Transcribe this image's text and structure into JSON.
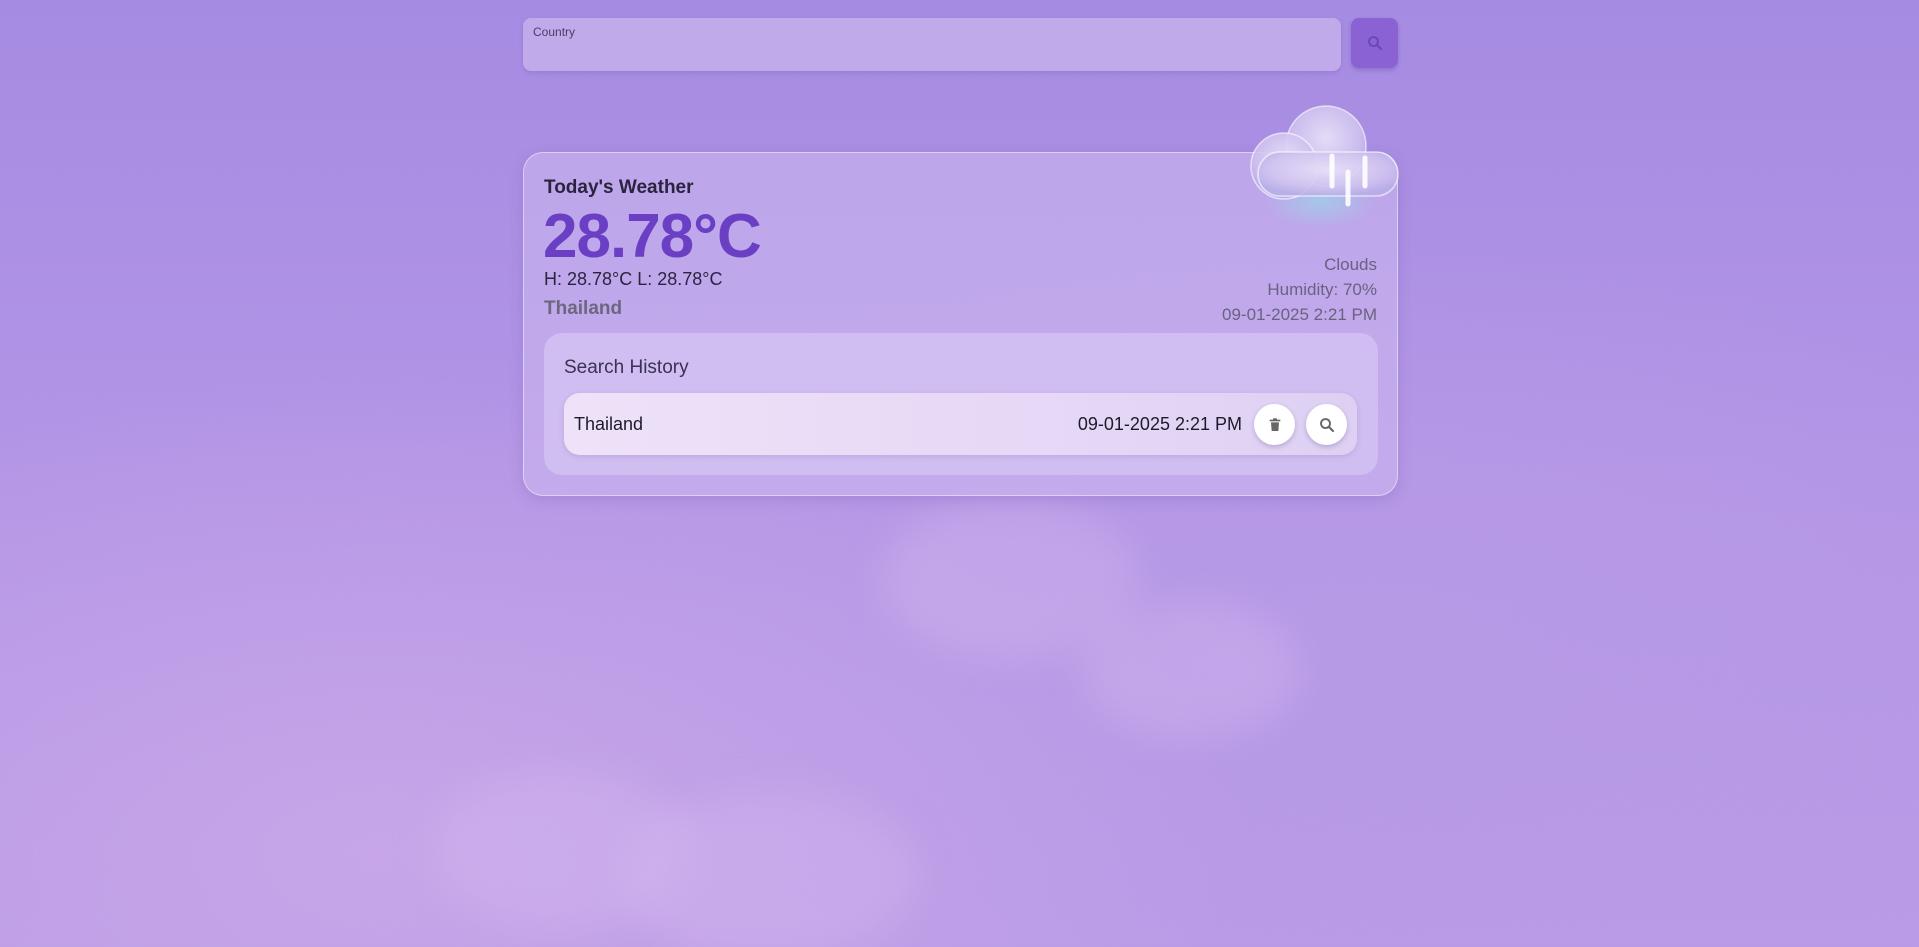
{
  "search": {
    "label": "Country",
    "value": "",
    "placeholder": ""
  },
  "weather": {
    "title": "Today's Weather",
    "temperature": "28.78°C",
    "high_low": "H: 28.78°C L: 28.78°C",
    "country": "Thailand",
    "condition": "Clouds",
    "humidity": "Humidity: 70%",
    "datetime": "09-01-2025 2:21 PM",
    "icon": "cloud-rain-icon"
  },
  "history": {
    "title": "Search History",
    "items": [
      {
        "name": "Thailand",
        "datetime": "09-01-2025 2:21 PM"
      }
    ]
  },
  "footer": {
    "line1": "",
    "line2": ""
  },
  "colors": {
    "accent": "#6b3fc4",
    "search_button": "#8a62d4",
    "background": "#ad90e4"
  }
}
